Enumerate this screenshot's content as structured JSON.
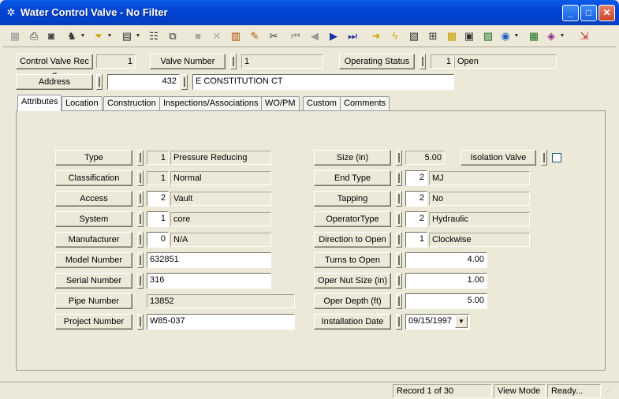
{
  "window": {
    "title": "Water Control Valve - No Filter"
  },
  "header": {
    "control_valve_rec_label": "Control Valve Rec #",
    "control_valve_rec_value": "1",
    "valve_number_label": "Valve Number",
    "valve_number_value": "1",
    "operating_status_label": "Operating Status",
    "operating_status_code": "1",
    "operating_status_value": "Open",
    "address_label": "Address",
    "address_number": "432",
    "address_street": "E CONSTITUTION CT"
  },
  "tabs": [
    "Attributes",
    "Location",
    "Construction",
    "Inspections/Associations",
    "WO/PM",
    "Custom",
    "Comments"
  ],
  "left_fields": [
    {
      "label": "Type",
      "code": "1",
      "value": "Pressure Reducing"
    },
    {
      "label": "Classification",
      "code": "1",
      "value": "Normal"
    },
    {
      "label": "Access",
      "code": "2",
      "value": "Vault"
    },
    {
      "label": "System",
      "code": "1",
      "value": "core"
    },
    {
      "label": "Manufacturer",
      "code": "0",
      "value": "N/A"
    },
    {
      "label": "Model Number",
      "value": "632851"
    },
    {
      "label": "Serial Number",
      "value": "316"
    },
    {
      "label": "Pipe Number",
      "value": "13852"
    },
    {
      "label": "Project Number",
      "value": "W85-037"
    }
  ],
  "right_fields": [
    {
      "label": "Size (in)",
      "value": "5.00"
    },
    {
      "label": "End Type",
      "code": "2",
      "value": "MJ"
    },
    {
      "label": "Tapping",
      "code": "2",
      "value": "No"
    },
    {
      "label": "OperatorType",
      "code": "2",
      "value": "Hydraulic"
    },
    {
      "label": "Direction to Open",
      "code": "1",
      "value": "Clockwise"
    },
    {
      "label": "Turns to Open",
      "value": "4.00"
    },
    {
      "label": "Oper Nut Size (in)",
      "value": "1.00"
    },
    {
      "label": "Oper Depth (ft)",
      "value": "5.00"
    },
    {
      "label": "Installation Date",
      "value": "09/15/1997"
    }
  ],
  "isolation_valve_label": "Isolation Valve",
  "status": {
    "record": "Record 1 of 30",
    "mode": "View Mode",
    "state": "Ready..."
  }
}
